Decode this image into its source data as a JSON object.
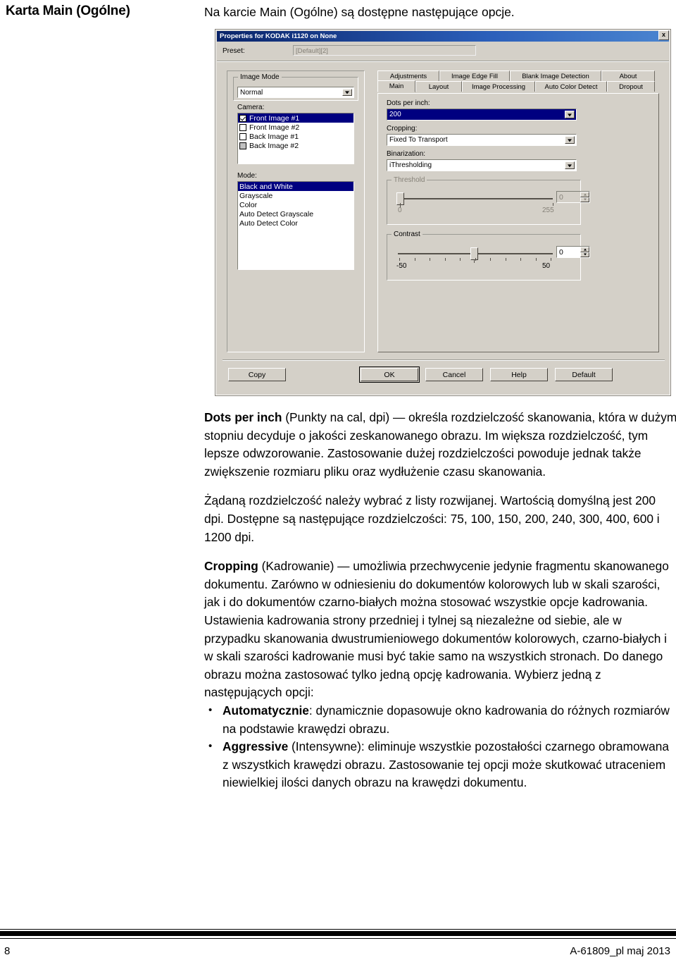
{
  "page": {
    "heading": "Karta Main (Ogólne)",
    "intro": "Na karcie Main (Ogólne) są dostępne następujące opcje."
  },
  "dialog": {
    "title": "Properties for KODAK i1120 on None",
    "close_label": "x",
    "preset": {
      "label": "Preset:",
      "value": "[Default][2]"
    },
    "image_mode": {
      "group_label": "Image Mode",
      "value": "Normal",
      "options": [
        "Normal"
      ]
    },
    "camera": {
      "label": "Camera:",
      "items": [
        {
          "label": "Front Image #1",
          "checked": true,
          "selected": true,
          "disabled": false
        },
        {
          "label": "Front Image #2",
          "checked": false,
          "selected": false,
          "disabled": false
        },
        {
          "label": "Back Image #1",
          "checked": false,
          "selected": false,
          "disabled": false
        },
        {
          "label": "Back Image #2",
          "checked": false,
          "selected": false,
          "disabled": true
        }
      ]
    },
    "mode": {
      "label": "Mode:",
      "items": [
        {
          "label": "Black and White",
          "selected": true
        },
        {
          "label": "Grayscale",
          "selected": false
        },
        {
          "label": "Color",
          "selected": false
        },
        {
          "label": "Auto Detect Grayscale",
          "selected": false
        },
        {
          "label": "Auto Detect Color",
          "selected": false
        }
      ]
    },
    "tabs_row1": [
      {
        "label": "Adjustments",
        "active": false
      },
      {
        "label": "Image Edge Fill",
        "active": false
      },
      {
        "label": "Blank Image Detection",
        "active": false
      },
      {
        "label": "About",
        "active": false
      }
    ],
    "tabs_row2": [
      {
        "label": "Main",
        "active": true
      },
      {
        "label": "Layout",
        "active": false
      },
      {
        "label": "Image Processing",
        "active": false
      },
      {
        "label": "Auto Color Detect",
        "active": false
      },
      {
        "label": "Dropout",
        "active": false
      }
    ],
    "dots_per_inch": {
      "label": "Dots per inch:",
      "value": "200"
    },
    "cropping": {
      "label": "Cropping:",
      "value": "Fixed To Transport"
    },
    "binarization": {
      "label": "Binarization:",
      "value": "iThresholding"
    },
    "threshold": {
      "group_label": "Threshold",
      "min_label": "0",
      "max_label": "255",
      "value": "0",
      "enabled": false
    },
    "contrast": {
      "group_label": "Contrast",
      "min_label": "-50",
      "max_label": "50",
      "value": "0",
      "enabled": true
    },
    "buttons": {
      "copy": "Copy",
      "ok": "OK",
      "cancel": "Cancel",
      "help": "Help",
      "default": "Default"
    }
  },
  "content": {
    "p1_bold": "Dots per inch",
    "p1_rest": " (Punkty na cal, dpi) — określa rozdzielczość skanowania, która w dużym stopniu decyduje o jakości zeskanowanego obrazu. Im większa rozdzielczość, tym lepsze odwzorowanie. Zastosowanie dużej rozdzielczości powoduje jednak także zwiększenie rozmiaru pliku oraz wydłużenie czasu skanowania.",
    "p2": "Żądaną rozdzielczość należy wybrać z listy rozwijanej. Wartością domyślną jest 200 dpi. Dostępne są następujące rozdzielczości: 75, 100, 150, 200, 240, 300, 400, 600 i 1200 dpi.",
    "p3_bold": "Cropping",
    "p3_rest": " (Kadrowanie) — umożliwia przechwycenie jedynie fragmentu skanowanego dokumentu. Zarówno w odniesieniu do dokumentów kolorowych lub w skali szarości, jak i do dokumentów czarno-białych można stosować wszystkie opcje kadrowania. Ustawienia kadrowania strony przedniej i tylnej są niezależne od siebie, ale w przypadku skanowania dwustrumieniowego dokumentów kolorowych, czarno-białych i w skali szarości kadrowanie musi być takie samo na wszystkich stronach. Do danego obrazu można zastosować tylko jedną opcję kadrowania. Wybierz jedną z następujących opcji:",
    "b1_bold": "Automatycznie",
    "b1_rest": ": dynamicznie dopasowuje okno kadrowania do różnych rozmiarów na podstawie krawędzi obrazu.",
    "b2_bold": "Aggressive",
    "b2_rest": " (Intensywne): eliminuje wszystkie pozostałości czarnego obramowana z wszystkich krawędzi obrazu. Zastosowanie tej opcji może skutkować utraceniem niewielkiej ilości danych obrazu na krawędzi dokumentu."
  },
  "footer": {
    "page_number": "8",
    "doc_id": "A-61809_pl maj 2013"
  }
}
